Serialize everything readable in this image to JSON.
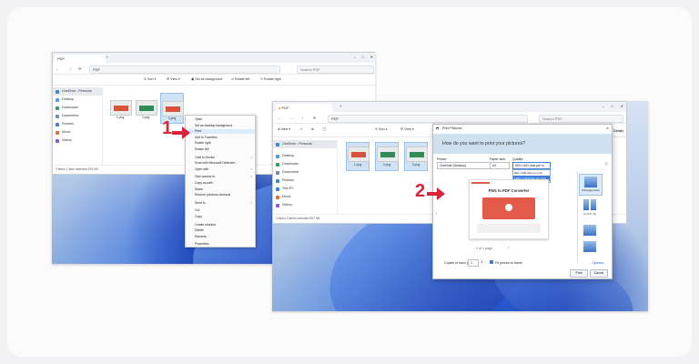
{
  "left": {
    "tab_title": "PDF",
    "address": "PDF",
    "search_placeholder": "Search PDF",
    "toolbar": [
      "Sort",
      "View",
      "Set as background",
      "Rotate left",
      "Rotate right"
    ],
    "sidebar": [
      "OneDrive - Personal",
      "Desktop",
      "Downloads",
      "Documents",
      "Pictures",
      "Music",
      "Videos",
      "This PC",
      "Network"
    ],
    "files": [
      "1.png",
      "2.png",
      "3.png"
    ],
    "status": "3 items   1 item selected   192 KB",
    "context_menu": [
      "Open",
      "Set as desktop background",
      "Print",
      "Add to Favorites",
      "Rotate right",
      "Rotate left",
      "Cast to Device",
      "Scan with Microsoft Defender...",
      "Open with",
      "Give access to",
      "Copy as path",
      "Share",
      "Restore previous versions",
      "Send to",
      "Cut",
      "Copy",
      "Create shortcut",
      "Delete",
      "Rename",
      "Properties"
    ]
  },
  "right": {
    "tab_title": "PDF",
    "address": "PDF",
    "search_placeholder": "Search PDF",
    "toolbar": [
      "New",
      "Sort",
      "View"
    ],
    "sidebar": [
      "OneDrive - Personal",
      "Desktop",
      "Downloads",
      "Documents",
      "Pictures",
      "This PC",
      "Music",
      "Videos"
    ],
    "files": [
      "1.png",
      "2.png",
      "3.png"
    ],
    "status": "3 items   3 items selected   557 KB",
    "details_label": "Details",
    "print_dialog": {
      "title": "Print Pictures",
      "question": "How do you want to print your pictures?",
      "printer_label": "Printer:",
      "printer_value": "OneNote (Desktop)",
      "paper_size_label": "Paper size:",
      "paper_size_value": "A4",
      "quality_label": "Quality:",
      "quality_options": [
        "600 x 600 dots per in",
        "600 x 600 dots per inch",
        "1200 x 1200 dots per inch"
      ],
      "preview_title": "PNG to PDF Converter",
      "page_counter": "1 of 1 page",
      "copies_label": "Copies of each picture:",
      "copies_value": "1",
      "fit_label": "Fit picture to frame",
      "options_link": "Options...",
      "print_button": "Print",
      "cancel_button": "Cancel",
      "layout_first": "Full page photo",
      "layout_second": "4 x 6 in. (2)"
    }
  },
  "steps": [
    "1",
    "2"
  ],
  "colors": {
    "accent_red": "#d9243a",
    "selection_blue": "#cfe3f7",
    "dialog_header": "#cfe0ef"
  }
}
